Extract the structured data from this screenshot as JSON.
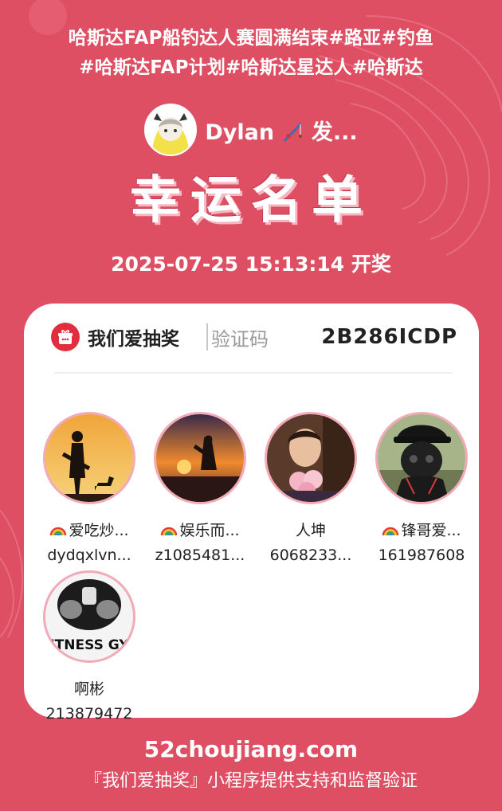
{
  "header": {
    "tag_line_1": "哈斯达FAP船钓达人赛圆满结束#路亚#钓鱼",
    "tag_line_2": "#哈斯达FAP计划#哈斯达星达人#哈斯达"
  },
  "host": {
    "name": "Dylan",
    "suffix": " 发...",
    "icon": "fishing-rod-icon"
  },
  "title": "幸运名单",
  "draw_time": "2025-07-25 15:13:14 开奖",
  "card": {
    "brand": "我们爱抽奖",
    "code_label": "验证码",
    "code_value": "2B286ICDP",
    "winners": [
      {
        "nickname": "爱吃炒...",
        "uid": "dydqxlvn...",
        "rainbow": true
      },
      {
        "nickname": "娱乐而...",
        "uid": "z1085481...",
        "rainbow": true
      },
      {
        "nickname": "人坤",
        "uid": "6068233...",
        "rainbow": false
      },
      {
        "nickname": "锋哥爱...",
        "uid": "161987608",
        "rainbow": true
      },
      {
        "nickname": "啊彬",
        "uid": "213879472",
        "rainbow": false,
        "avatar_text": "ITNESS GY"
      }
    ]
  },
  "footer": {
    "site": "52choujiang.com",
    "note": "『我们爱抽奖』小程序提供支持和监督验证"
  },
  "colors": {
    "background": "#de4f63",
    "avatar_ring": "#f1aab6",
    "brand_red": "#e02e3d"
  }
}
